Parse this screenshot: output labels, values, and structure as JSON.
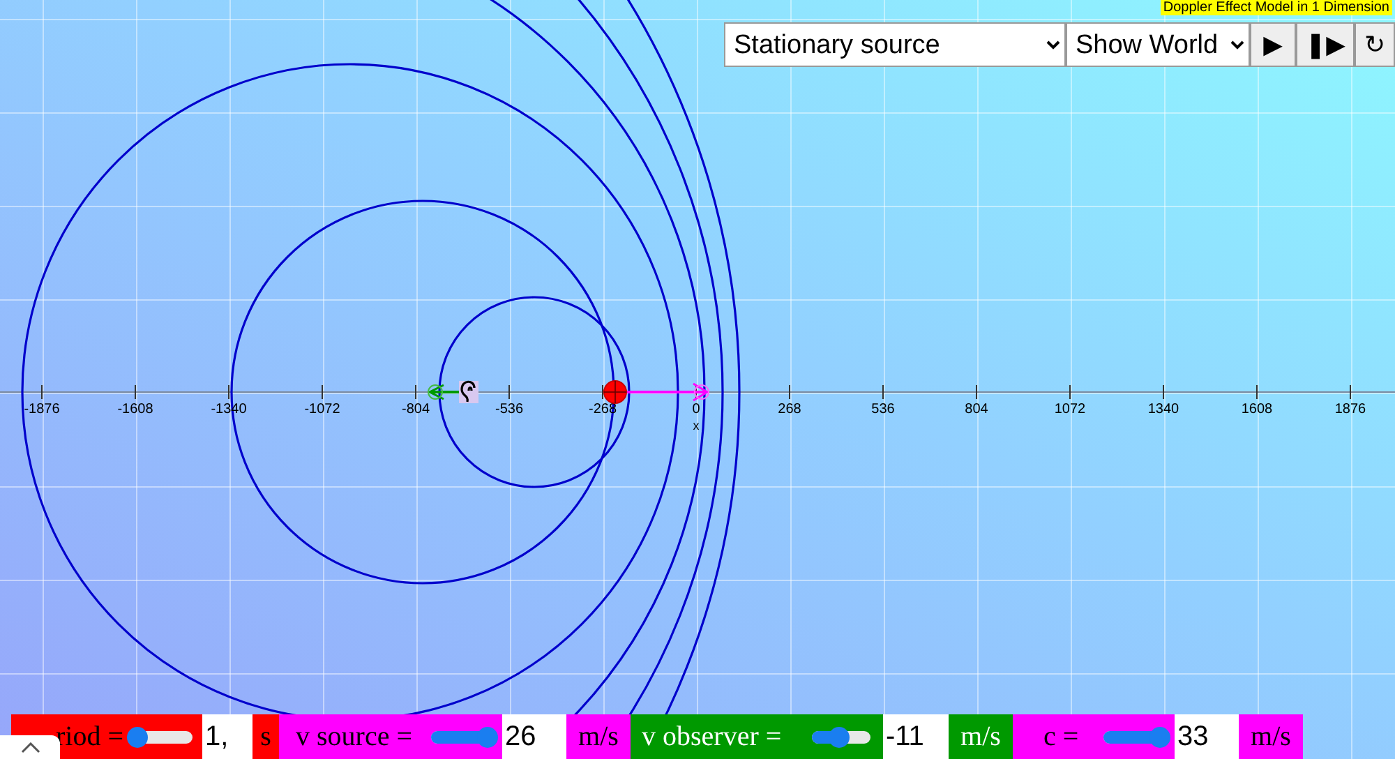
{
  "title_badge": "Doppler Effect Model in 1 Dimension",
  "toolbar": {
    "mode_select": "Stationary source",
    "view_select": "Show World",
    "buttons": [
      {
        "kind": "play",
        "label": "▶"
      },
      {
        "kind": "step",
        "label": "❚▶"
      },
      {
        "kind": "reset",
        "label": "↻"
      }
    ]
  },
  "axis": {
    "ticks": [
      "-1876",
      "-1608",
      "-1340",
      "-1072",
      "-804",
      "-536",
      "-268",
      "0",
      "268",
      "536",
      "804",
      "1072",
      "1340",
      "1608",
      "1876"
    ],
    "label": "x"
  },
  "controls": [
    {
      "label": "riod =",
      "color": "#ff0000",
      "level": 0.05,
      "value": "1,",
      "unit": "s"
    },
    {
      "label": "v source =",
      "color": "#ff00ff",
      "level": 0.95,
      "value": "26",
      "unit": "m/s"
    },
    {
      "label": "v observer =",
      "color": "#009900",
      "level": 0.45,
      "value": "-11",
      "unit": "m/s"
    },
    {
      "label": "c =",
      "color": "#ff00ff",
      "level": 0.95,
      "value": "33",
      "unit": "m/s"
    }
  ]
}
